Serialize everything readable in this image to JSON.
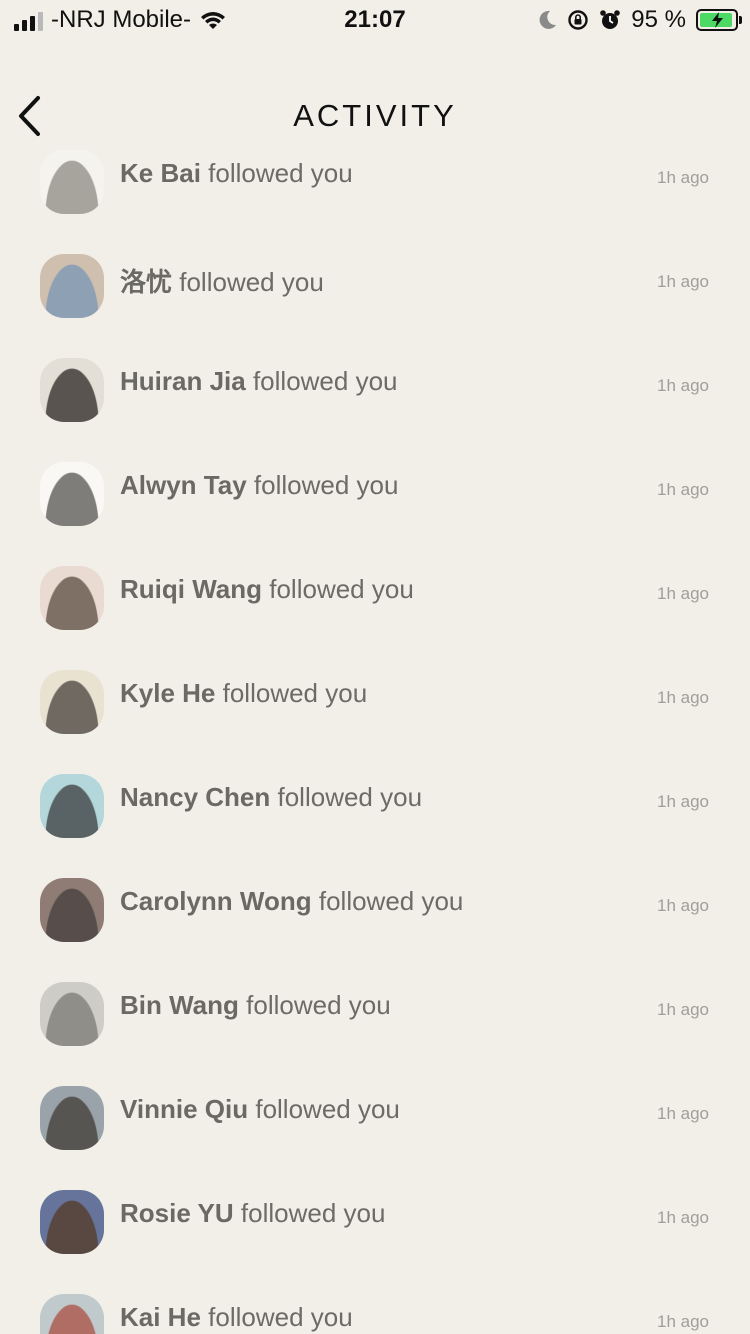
{
  "status_bar": {
    "carrier": "-NRJ Mobile-",
    "time": "21:07",
    "battery_percent": "95 %",
    "battery_level": 0.95
  },
  "header": {
    "title": "ACTIVITY"
  },
  "activity": {
    "items": [
      {
        "name": "Ke Bai",
        "action": "followed you",
        "time": "1h ago",
        "avatar_colors": [
          "#f6f4ef",
          "#9a9891"
        ]
      },
      {
        "name": "洛忧",
        "action": "followed you",
        "time": "1h ago",
        "avatar_colors": [
          "#c9b7a6",
          "#7d93ab"
        ]
      },
      {
        "name": "Huiran Jia",
        "action": "followed you",
        "time": "1h ago",
        "avatar_colors": [
          "#e2ddd4",
          "#3f3a36"
        ]
      },
      {
        "name": "Alwyn Tay",
        "action": "followed you",
        "time": "1h ago",
        "avatar_colors": [
          "#fbfaf7",
          "#6c6a66"
        ]
      },
      {
        "name": "Ruiqi Wang",
        "action": "followed you",
        "time": "1h ago",
        "avatar_colors": [
          "#e8d8cf",
          "#6b5a4f"
        ]
      },
      {
        "name": "Kyle He",
        "action": "followed you",
        "time": "1h ago",
        "avatar_colors": [
          "#e9e0cc",
          "#5a524b"
        ]
      },
      {
        "name": "Nancy Chen",
        "action": "followed you",
        "time": "1h ago",
        "avatar_colors": [
          "#a9d3d8",
          "#3f4a4f"
        ]
      },
      {
        "name": "Carolynn Wong",
        "action": "followed you",
        "time": "1h ago",
        "avatar_colors": [
          "#7e6a62",
          "#3d3330"
        ]
      },
      {
        "name": "Bin Wang",
        "action": "followed you",
        "time": "1h ago",
        "avatar_colors": [
          "#c7c7c2",
          "#7f7e78"
        ]
      },
      {
        "name": "Vinnie Qiu",
        "action": "followed you",
        "time": "1h ago",
        "avatar_colors": [
          "#8d96a0",
          "#3c3b38"
        ]
      },
      {
        "name": "Rosie YU",
        "action": "followed you",
        "time": "1h ago",
        "avatar_colors": [
          "#4e5f8e",
          "#3f2a26"
        ]
      },
      {
        "name": "Kai He",
        "action": "followed you",
        "time": "1h ago",
        "avatar_colors": [
          "#b8c4c9",
          "#a5574e"
        ]
      }
    ]
  }
}
